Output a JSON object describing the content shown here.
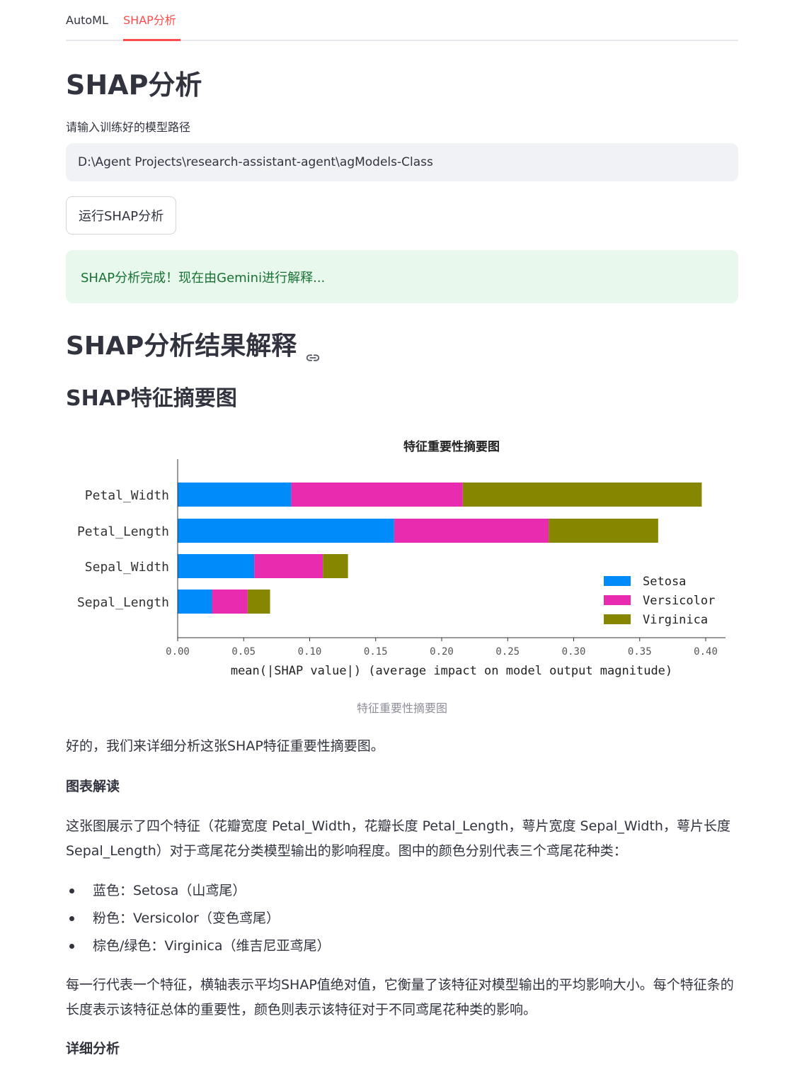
{
  "tabs": [
    {
      "label": "AutoML",
      "active": false
    },
    {
      "label": "SHAP分析",
      "active": true
    }
  ],
  "page_title": "SHAP分析",
  "model_path": {
    "label": "请输入训练好的模型路径",
    "value": "D:\\Agent Projects\\research-assistant-agent\\agModels-Class"
  },
  "run_button": "运行SHAP分析",
  "success_message": "SHAP分析完成！现在由Gemini进行解释...",
  "results_heading": "SHAP分析结果解释",
  "summary_heading": "SHAP特征摘要图",
  "chart_caption": "特征重要性摘要图",
  "chart_data": {
    "type": "bar",
    "orientation": "horizontal",
    "stacked": true,
    "title": "特征重要性摘要图",
    "xlabel": "mean(|SHAP value|) (average impact on model output magnitude)",
    "ylabel": "",
    "xlim": [
      0,
      0.415
    ],
    "xticks": [
      "0.00",
      "0.05",
      "0.10",
      "0.15",
      "0.20",
      "0.25",
      "0.30",
      "0.35",
      "0.40"
    ],
    "categories": [
      "Petal_Width",
      "Petal_Length",
      "Sepal_Width",
      "Sepal_Length"
    ],
    "series": [
      {
        "name": "Setosa",
        "color": "#008bfb",
        "values": [
          0.086,
          0.164,
          0.058,
          0.026
        ]
      },
      {
        "name": "Versicolor",
        "color": "#e92bb0",
        "values": [
          0.13,
          0.117,
          0.052,
          0.027
        ]
      },
      {
        "name": "Virginica",
        "color": "#868600",
        "values": [
          0.181,
          0.083,
          0.019,
          0.017
        ]
      }
    ],
    "legend": "lower-right",
    "grid": false
  },
  "intro": "好的，我们来详细分析这张SHAP特征重要性摘要图。",
  "section1_title": "图表解读",
  "section1_para": "这张图展示了四个特征（花瓣宽度 Petal_Width，花瓣长度 Petal_Length，萼片宽度 Sepal_Width，萼片长度 Sepal_Length）对于鸢尾花分类模型输出的影响程度。图中的颜色分别代表三个鸢尾花种类：",
  "color_list": [
    "蓝色：Setosa（山鸢尾）",
    "粉色：Versicolor（变色鸢尾）",
    "棕色/绿色：Virginica（维吉尼亚鸢尾）"
  ],
  "section1_para2": "每一行代表一个特征，横轴表示平均SHAP值绝对值，它衡量了该特征对模型输出的平均影响大小。每个特征条的长度表示该特征总体的重要性，颜色则表示该特征对于不同鸢尾花种类的影响。",
  "section2_title": "详细分析"
}
